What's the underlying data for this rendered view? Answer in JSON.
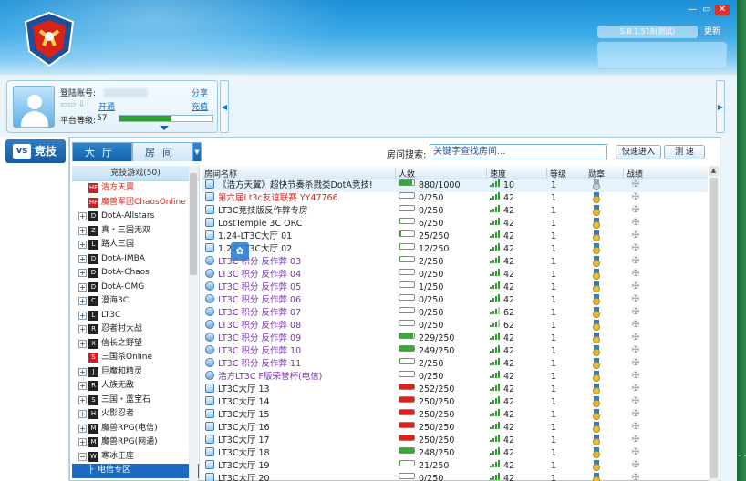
{
  "window": {
    "minimize": "—",
    "restore": "▭",
    "close": "✕"
  },
  "header": {
    "version": "5.8.1.518(测试)",
    "update_label": "更新"
  },
  "user": {
    "account_label": "登陆账号:",
    "share_link": "分享",
    "open_link": "开通",
    "recharge_link": "充值",
    "level_label": "平台等级:",
    "level_value": "57",
    "level_progress": 0.56
  },
  "left_nav": {
    "competition_label": "竞技",
    "competition_icon": "vs-icon"
  },
  "tabs": [
    {
      "label": "大厅"
    },
    {
      "label": "房间"
    }
  ],
  "search": {
    "label": "房间搜索:",
    "placeholder": "关键字查找房间..."
  },
  "buttons": {
    "quick_join": "快速进入",
    "speed_test": "测 速"
  },
  "tree": {
    "header": "竞技游戏(50)",
    "items": [
      {
        "label": "浩方天翼",
        "color": "#d8231b",
        "expander": "",
        "icon": "HF"
      },
      {
        "label": "魔兽军团ChaosOnline",
        "color": "#d8231b",
        "expander": "",
        "icon": "HF"
      },
      {
        "label": "DotA-Allstars",
        "color": "#222222",
        "expander": "+",
        "icon": "D"
      },
      {
        "label": "真・三国无双",
        "color": "#222222",
        "expander": "+",
        "icon": "Z"
      },
      {
        "label": "路人三国",
        "color": "#222222",
        "expander": "+",
        "icon": "L"
      },
      {
        "label": "DotA-IMBA",
        "color": "#222222",
        "expander": "+",
        "icon": "D"
      },
      {
        "label": "DotA-Chaos",
        "color": "#222222",
        "expander": "+",
        "icon": "D"
      },
      {
        "label": "DotA-OMG",
        "color": "#222222",
        "expander": "+",
        "icon": "D"
      },
      {
        "label": "澄海3C",
        "color": "#222222",
        "expander": "+",
        "icon": "C"
      },
      {
        "label": "LT3C",
        "color": "#222222",
        "expander": "+",
        "icon": "L"
      },
      {
        "label": "忍者村大战",
        "color": "#222222",
        "expander": "+",
        "icon": "R"
      },
      {
        "label": "信长之野望",
        "color": "#222222",
        "expander": "+",
        "icon": "X"
      },
      {
        "label": "三国杀Online",
        "color": "#222222",
        "expander": "",
        "icon": "S"
      },
      {
        "label": "巨魔和精灵",
        "color": "#222222",
        "expander": "+",
        "icon": "J"
      },
      {
        "label": "人族无敌",
        "color": "#222222",
        "expander": "+",
        "icon": "R"
      },
      {
        "label": "三国・蓝宝石",
        "color": "#222222",
        "expander": "+",
        "icon": "S"
      },
      {
        "label": "火影忍者",
        "color": "#222222",
        "expander": "+",
        "icon": "H"
      },
      {
        "label": "魔兽RPG(电信)",
        "color": "#222222",
        "expander": "+",
        "icon": "M"
      },
      {
        "label": "魔兽RPG(网通)",
        "color": "#222222",
        "expander": "+",
        "icon": "M"
      },
      {
        "label": "寒冰王座",
        "color": "#222222",
        "expander": "−",
        "icon": "W"
      },
      {
        "label": "电信专区",
        "color": "#ffffff",
        "expander": "",
        "icon": ""
      }
    ]
  },
  "room_list": {
    "columns": {
      "name": "房间名称",
      "people": "人数",
      "speed": "速度",
      "level": "等级",
      "medal": "勋章",
      "record": "战绩"
    },
    "rows": [
      {
        "name": "《浩方天翼》超快节奏杀戮类DotA竞技!",
        "people": "880/1000",
        "fill": 0.88,
        "speed": "10",
        "level": "1",
        "color": "#222222",
        "bar": "#3aa63a",
        "icon": "house",
        "medal": "gray"
      },
      {
        "name": "第六届Lt3c友谊联赛 YY47766",
        "people": "0/250",
        "fill": 0,
        "speed": "42",
        "level": "1",
        "color": "#d8231b",
        "bar": "#3aa63a",
        "icon": "house",
        "medal": "gold"
      },
      {
        "name": "LT3C竞技版反作弊专房",
        "people": "0/250",
        "fill": 0,
        "speed": "42",
        "level": "1",
        "color": "#222222",
        "bar": "#3aa63a",
        "icon": "house",
        "medal": "gold"
      },
      {
        "name": "LostTemple 3C ORC",
        "people": "6/250",
        "fill": 0.024,
        "speed": "42",
        "level": "1",
        "color": "#222222",
        "bar": "#3aa63a",
        "icon": "house",
        "medal": "gold"
      },
      {
        "name": "1.24-LT3C大厅 01",
        "people": "25/250",
        "fill": 0.1,
        "speed": "42",
        "level": "1",
        "color": "#222222",
        "bar": "#3aa63a",
        "icon": "house",
        "medal": "gold"
      },
      {
        "name": "1.24-LT3C大厅 02",
        "people": "12/250",
        "fill": 0.048,
        "speed": "42",
        "level": "1",
        "color": "#222222",
        "bar": "#3aa63a",
        "icon": "house",
        "medal": "gold"
      },
      {
        "name": "LT3C 积分 反作弊 03",
        "people": "2/250",
        "fill": 0.008,
        "speed": "42",
        "level": "1",
        "color": "#7a2fb0",
        "bar": "#3aa63a",
        "icon": "key",
        "medal": "gold"
      },
      {
        "name": "LT3C 积分 反作弊 04",
        "people": "0/250",
        "fill": 0,
        "speed": "42",
        "level": "1",
        "color": "#7a2fb0",
        "bar": "#3aa63a",
        "icon": "key",
        "medal": "gold"
      },
      {
        "name": "LT3C 积分 反作弊 05",
        "people": "1/250",
        "fill": 0.004,
        "speed": "42",
        "level": "1",
        "color": "#7a2fb0",
        "bar": "#3aa63a",
        "icon": "key",
        "medal": "gold"
      },
      {
        "name": "LT3C 积分 反作弊 06",
        "people": "0/250",
        "fill": 0,
        "speed": "42",
        "level": "1",
        "color": "#7a2fb0",
        "bar": "#3aa63a",
        "icon": "key",
        "medal": "gold"
      },
      {
        "name": "LT3C 积分 反作弊 07",
        "people": "0/250",
        "fill": 0,
        "speed": "62",
        "level": "1",
        "color": "#7a2fb0",
        "bar": "#3aa63a",
        "icon": "key",
        "medal": "gold"
      },
      {
        "name": "LT3C 积分 反作弊 08",
        "people": "0/250",
        "fill": 0,
        "speed": "62",
        "level": "1",
        "color": "#7a2fb0",
        "bar": "#3aa63a",
        "icon": "key",
        "medal": "gold"
      },
      {
        "name": "LT3C 积分 反作弊 09",
        "people": "229/250",
        "fill": 0.916,
        "speed": "42",
        "level": "1",
        "color": "#7a2fb0",
        "bar": "#3aa63a",
        "icon": "key",
        "medal": "gold"
      },
      {
        "name": "LT3C 积分 反作弊 10",
        "people": "249/250",
        "fill": 0.996,
        "speed": "42",
        "level": "1",
        "color": "#7a2fb0",
        "bar": "#3aa63a",
        "icon": "key",
        "medal": "gold"
      },
      {
        "name": "LT3C 积分 反作弊 11",
        "people": "2/250",
        "fill": 0.008,
        "speed": "42",
        "level": "1",
        "color": "#7a2fb0",
        "bar": "#3aa63a",
        "icon": "key",
        "medal": "gold"
      },
      {
        "name": "浩方LT3C F版荣誉杯(电信)",
        "people": "0/250",
        "fill": 0,
        "speed": "42",
        "level": "1",
        "color": "#7a2fb0",
        "bar": "#3aa63a",
        "icon": "key",
        "medal": "gold"
      },
      {
        "name": "LT3C大厅 13",
        "people": "252/250",
        "fill": 1,
        "speed": "42",
        "level": "1",
        "color": "#222222",
        "bar": "#d8231b",
        "icon": "house",
        "medal": "gold"
      },
      {
        "name": "LT3C大厅 14",
        "people": "250/250",
        "fill": 1,
        "speed": "42",
        "level": "1",
        "color": "#222222",
        "bar": "#d8231b",
        "icon": "house",
        "medal": "gold"
      },
      {
        "name": "LT3C大厅 15",
        "people": "250/250",
        "fill": 1,
        "speed": "42",
        "level": "1",
        "color": "#222222",
        "bar": "#d8231b",
        "icon": "house",
        "medal": "gold"
      },
      {
        "name": "LT3C大厅 16",
        "people": "250/250",
        "fill": 1,
        "speed": "42",
        "level": "1",
        "color": "#222222",
        "bar": "#d8231b",
        "icon": "house",
        "medal": "gold"
      },
      {
        "name": "LT3C大厅 17",
        "people": "250/250",
        "fill": 1,
        "speed": "42",
        "level": "1",
        "color": "#222222",
        "bar": "#d8231b",
        "icon": "house",
        "medal": "gold"
      },
      {
        "name": "LT3C大厅 18",
        "people": "248/250",
        "fill": 0.992,
        "speed": "42",
        "level": "1",
        "color": "#222222",
        "bar": "#3aa63a",
        "icon": "house",
        "medal": "gold"
      },
      {
        "name": "LT3C大厅 19",
        "people": "21/250",
        "fill": 0.084,
        "speed": "42",
        "level": "1",
        "color": "#222222",
        "bar": "#3aa63a",
        "icon": "house",
        "medal": "gold"
      },
      {
        "name": "LT3C大厅 20",
        "people": "0/250",
        "fill": 0,
        "speed": "42",
        "level": "1",
        "color": "#222222",
        "bar": "#3aa63a",
        "icon": "house",
        "medal": "gold"
      }
    ]
  }
}
